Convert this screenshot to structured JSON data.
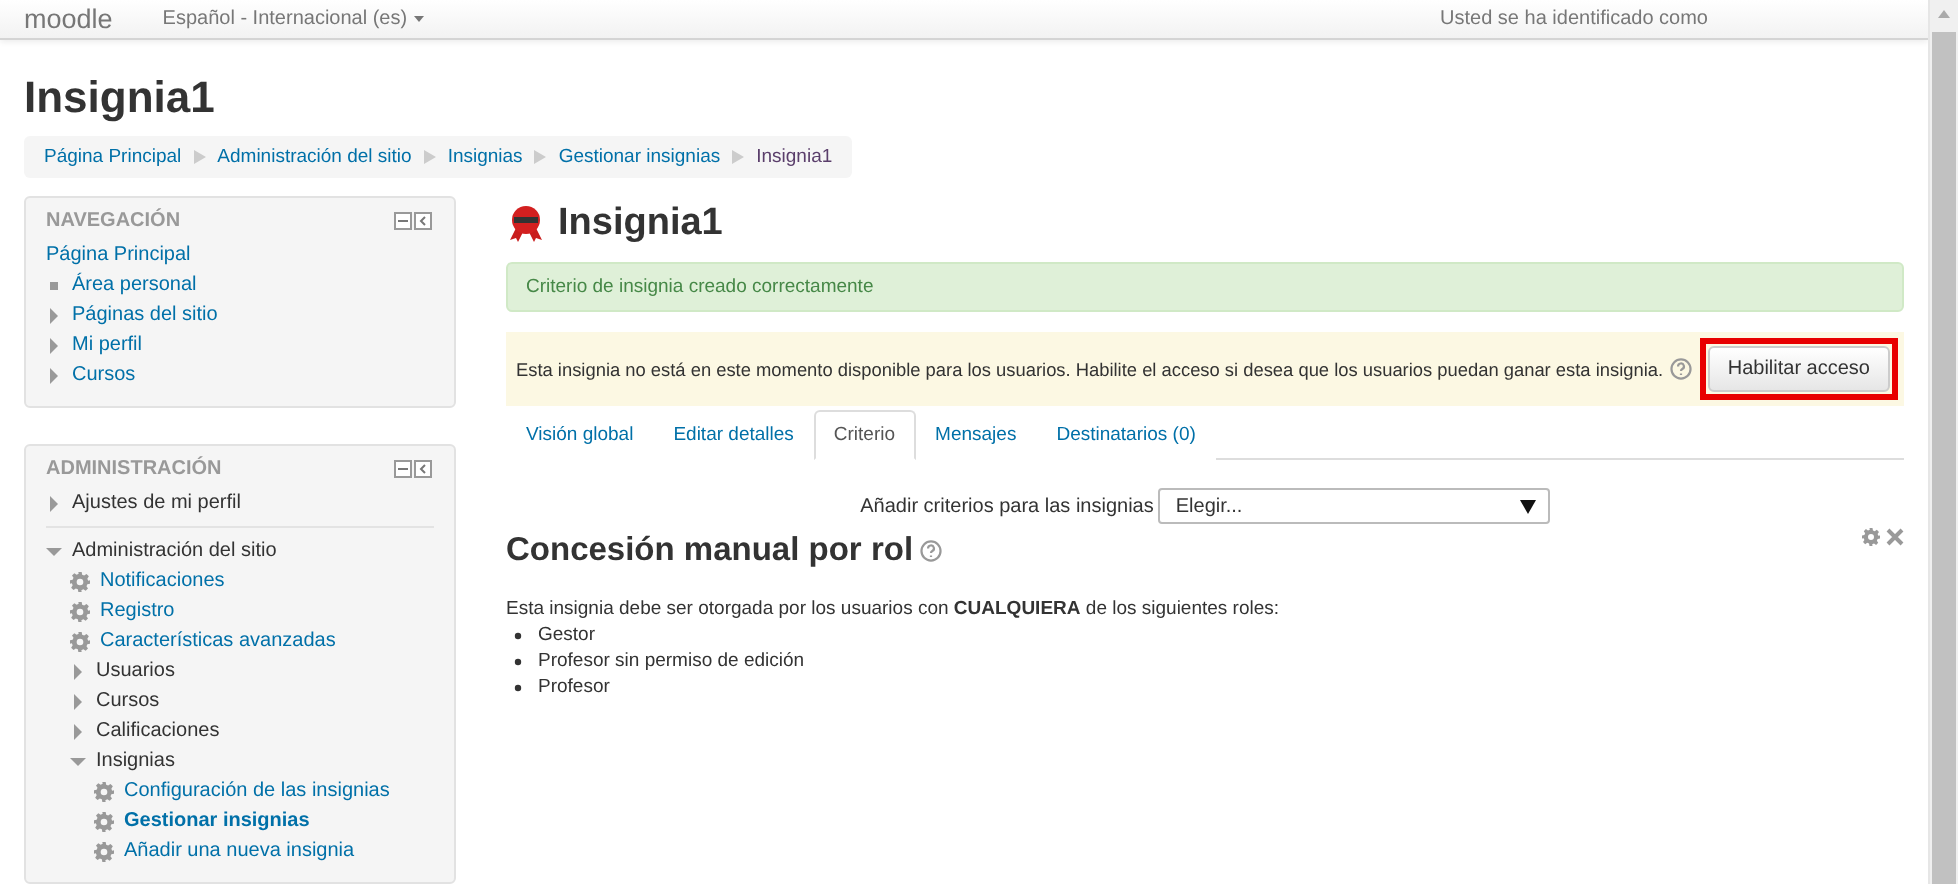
{
  "navbar": {
    "brand": "moodle",
    "language": "Español - Internacional (es)",
    "user_text": "Usted se ha identificado como"
  },
  "page_title": "Insignia1",
  "breadcrumb": [
    {
      "label": "Página Principal",
      "current": false
    },
    {
      "label": "Administración del sitio",
      "current": false
    },
    {
      "label": "Insignias",
      "current": false
    },
    {
      "label": "Gestionar insignias",
      "current": false
    },
    {
      "label": "Insignia1",
      "current": true
    }
  ],
  "navigation_block": {
    "title": "NAVEGACIÓN",
    "items": [
      {
        "label": "Página Principal",
        "kind": "home"
      },
      {
        "label": "Área personal",
        "kind": "leaf"
      },
      {
        "label": "Páginas del sitio",
        "kind": "branch",
        "expanded": false
      },
      {
        "label": "Mi perfil",
        "kind": "branch",
        "expanded": false
      },
      {
        "label": "Cursos",
        "kind": "branch",
        "expanded": false
      }
    ]
  },
  "administration_block": {
    "title": "ADMINISTRACIÓN",
    "items": [
      {
        "label": "Ajustes de mi perfil",
        "kind": "branch",
        "expanded": false
      },
      {
        "label": "Administración del sitio",
        "kind": "branch",
        "expanded": true,
        "children": [
          {
            "label": "Notificaciones",
            "kind": "setting"
          },
          {
            "label": "Registro",
            "kind": "setting"
          },
          {
            "label": "Características avanzadas",
            "kind": "setting"
          },
          {
            "label": "Usuarios",
            "kind": "branch",
            "expanded": false
          },
          {
            "label": "Cursos",
            "kind": "branch",
            "expanded": false
          },
          {
            "label": "Calificaciones",
            "kind": "branch",
            "expanded": false
          },
          {
            "label": "Insignias",
            "kind": "branch",
            "expanded": true,
            "children": [
              {
                "label": "Configuración de las insignias",
                "kind": "setting",
                "selected": false
              },
              {
                "label": "Gestionar insignias",
                "kind": "setting",
                "selected": true
              },
              {
                "label": "Añadir una nueva insignia",
                "kind": "setting",
                "selected": false
              }
            ]
          }
        ]
      }
    ]
  },
  "badge_heading": "Insignia1",
  "success_message": "Criterio de insignia creado correctamente",
  "warning": {
    "text": "Esta insignia no está en este momento disponible para los usuarios. Habilite el acceso si desea que los usuarios puedan ganar esta insignia.",
    "button": "Habilitar acceso"
  },
  "tabs": [
    {
      "label": "Visión global",
      "selected": false
    },
    {
      "label": "Editar detalles",
      "selected": false
    },
    {
      "label": "Criterio",
      "selected": true
    },
    {
      "label": "Mensajes",
      "selected": false
    },
    {
      "label": "Destinatarios (0)",
      "selected": false
    }
  ],
  "criteria_select": {
    "label": "Añadir criterios para las insignias",
    "value": "Elegir..."
  },
  "criterion": {
    "title": "Concesión manual por rol",
    "description": "Esta insignia debe ser otorgada por los usuarios con **CUALQUIERA** de los siguientes roles:",
    "roles": [
      "Gestor",
      "Profesor sin permiso de edición",
      "Profesor"
    ]
  }
}
